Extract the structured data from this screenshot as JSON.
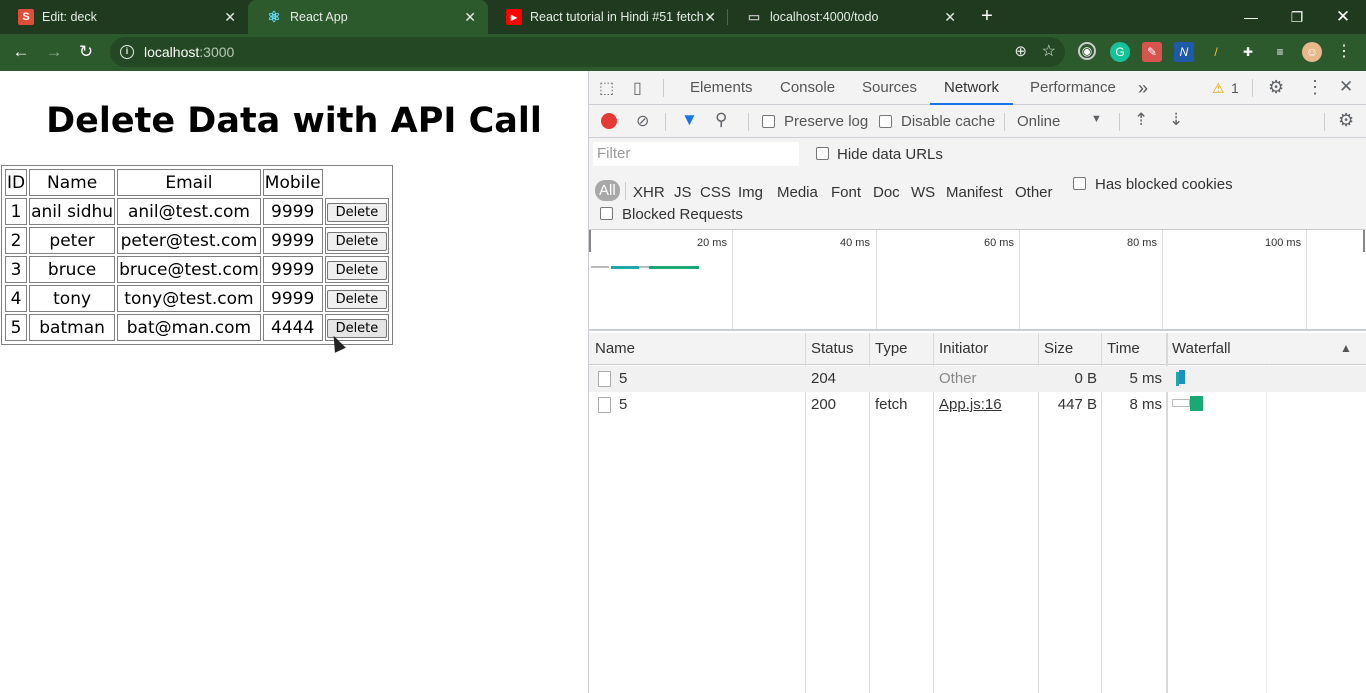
{
  "browser": {
    "tabs": [
      {
        "title": "Edit: deck",
        "favicon": "S",
        "favicon_color": "#e04e39"
      },
      {
        "title": "React App",
        "favicon": "⚛",
        "favicon_color": "#61dafb"
      },
      {
        "title": "React tutorial in Hindi #51 fetch /",
        "favicon": "▶",
        "favicon_color": "#ff0000"
      },
      {
        "title": "localhost:4000/todo",
        "favicon": "▭",
        "favicon_color": "#888888"
      }
    ],
    "url_host": "localhost",
    "url_port": ":3000"
  },
  "page": {
    "heading": "Delete Data with API Call",
    "columns": [
      "ID",
      "Name",
      "Email",
      "Mobile"
    ],
    "rows": [
      {
        "id": "1",
        "name": "anil sidhu",
        "email": "anil@test.com",
        "mobile": "9999"
      },
      {
        "id": "2",
        "name": "peter",
        "email": "peter@test.com",
        "mobile": "9999"
      },
      {
        "id": "3",
        "name": "bruce",
        "email": "bruce@test.com",
        "mobile": "9999"
      },
      {
        "id": "4",
        "name": "tony",
        "email": "tony@test.com",
        "mobile": "9999"
      },
      {
        "id": "5",
        "name": "batman",
        "email": "bat@man.com",
        "mobile": "4444"
      }
    ],
    "delete_label": "Delete"
  },
  "devtools": {
    "tabs": [
      "Elements",
      "Console",
      "Sources",
      "Network",
      "Performance"
    ],
    "more": "»",
    "warning_count": "1",
    "preserve_log": "Preserve log",
    "disable_cache": "Disable cache",
    "throttle": "Online",
    "filter_placeholder": "Filter",
    "hide_data_urls": "Hide data URLs",
    "types": [
      "All",
      "XHR",
      "JS",
      "CSS",
      "Img",
      "Media",
      "Font",
      "Doc",
      "WS",
      "Manifest",
      "Other"
    ],
    "has_blocked_cookies": "Has blocked cookies",
    "blocked_requests": "Blocked Requests",
    "timeline": [
      "20 ms",
      "40 ms",
      "60 ms",
      "80 ms",
      "100 ms"
    ],
    "headers": [
      "Name",
      "Status",
      "Type",
      "Initiator",
      "Size",
      "Time",
      "Waterfall"
    ],
    "requests": [
      {
        "name": "5",
        "status": "204",
        "type": "",
        "initiator": "Other",
        "size": "0 B",
        "time": "5 ms"
      },
      {
        "name": "5",
        "status": "200",
        "type": "fetch",
        "initiator": "App.js:16",
        "size": "447 B",
        "time": "8 ms"
      }
    ]
  }
}
